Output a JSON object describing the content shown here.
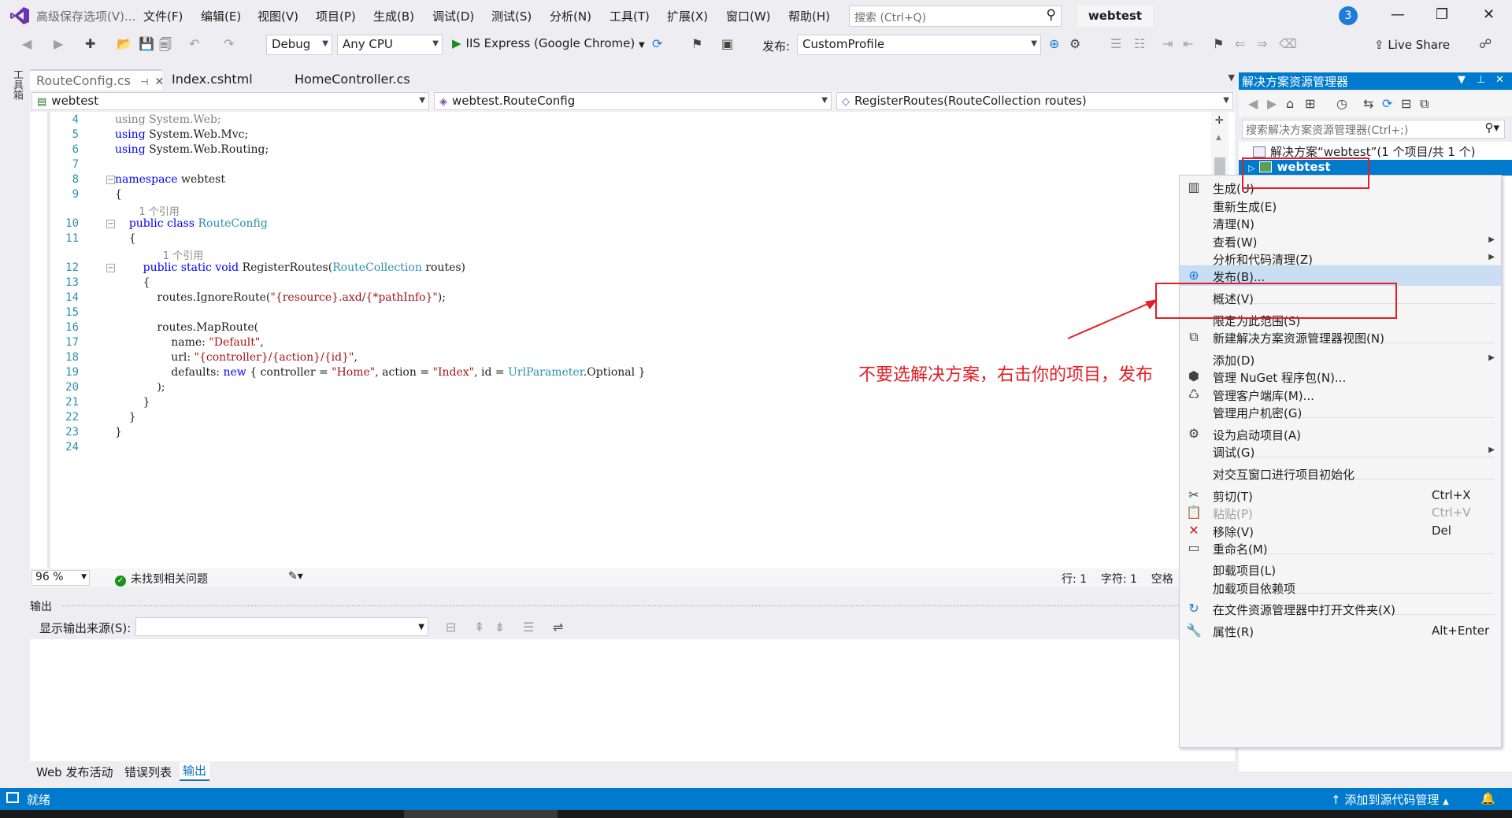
{
  "window": {
    "title_faded": "高级保存选项(V)...",
    "menus": [
      "文件(F)",
      "编辑(E)",
      "视图(V)",
      "项目(P)",
      "生成(B)",
      "调试(D)",
      "测试(S)",
      "分析(N)",
      "工具(T)",
      "扩展(X)",
      "窗口(W)",
      "帮助(H)"
    ],
    "search_placeholder": "搜索 (Ctrl+Q)",
    "solution_name": "webtest",
    "notification_count": "3",
    "minimize": "—",
    "restore": "❐",
    "close": "✕"
  },
  "toolbar": {
    "config": "Debug",
    "platform": "Any CPU",
    "run_target": "IIS Express (Google Chrome)",
    "publish_label": "发布:",
    "publish_profile": "CustomProfile",
    "live_share": "Live Share"
  },
  "toolbox_strip": "工具箱",
  "doc_tabs": [
    {
      "label": "RouteConfig.cs",
      "pin": "⊣",
      "close": "✕"
    },
    {
      "label": "Index.cshtml"
    },
    {
      "label": "HomeController.cs"
    }
  ],
  "navbar": {
    "project": "webtest",
    "class": "webtest.RouteConfig",
    "member": "RegisterRoutes(RouteCollection routes)"
  },
  "code": {
    "ref_hint": "1 个引用",
    "lines": [
      {
        "n": "4",
        "html": "<span class=\"gr\">using System.Web;</span>"
      },
      {
        "n": "5",
        "html": "<span class=\"kw\">using</span> System.Web.Mvc;"
      },
      {
        "n": "6",
        "html": "<span class=\"kw\">using</span> System.Web.Routing;"
      },
      {
        "n": "7",
        "html": ""
      },
      {
        "n": "8",
        "html": "<span class=\"kw\">namespace</span> webtest",
        "fold": true
      },
      {
        "n": "9",
        "html": "{"
      },
      {
        "n": "10",
        "html": "    <span class=\"kw\">public class</span> <span class=\"ty\">RouteConfig</span>",
        "fold": true,
        "hint": true
      },
      {
        "n": "11",
        "html": "    {"
      },
      {
        "n": "12",
        "html": "        <span class=\"kw\">public static void</span> RegisterRoutes(<span class=\"ty\">RouteCollection</span> routes)",
        "fold": true,
        "hint": true
      },
      {
        "n": "13",
        "html": "        {"
      },
      {
        "n": "14",
        "html": "            routes.IgnoreRoute(<span class=\"st\">\"{resource}.axd/{*pathInfo}\"</span>);"
      },
      {
        "n": "15",
        "html": ""
      },
      {
        "n": "16",
        "html": "            routes.MapRoute("
      },
      {
        "n": "17",
        "html": "                name: <span class=\"st\">\"Default\"</span>,"
      },
      {
        "n": "18",
        "html": "                url: <span class=\"st\">\"{controller}/{action}/{id}\"</span>,"
      },
      {
        "n": "19",
        "html": "                defaults: <span class=\"kw\">new</span> { controller = <span class=\"st\">\"Home\"</span>, action = <span class=\"st\">\"Index\"</span>, id = <span class=\"ty\">UrlParameter</span>.Optional }"
      },
      {
        "n": "20",
        "html": "            );"
      },
      {
        "n": "21",
        "html": "        }"
      },
      {
        "n": "22",
        "html": "    }"
      },
      {
        "n": "23",
        "html": "}"
      },
      {
        "n": "24",
        "html": ""
      }
    ]
  },
  "editor_status": {
    "zoom": "96 %",
    "issues": "未找到相关问题",
    "line": "行: 1",
    "char": "字符: 1",
    "space": "空格"
  },
  "output": {
    "title": "输出",
    "source_label": "显示输出来源(S):",
    "source_value": ""
  },
  "bottom_tabs": [
    "Web 发布活动",
    "错误列表",
    "输出"
  ],
  "solution_explorer": {
    "title": "解决方案资源管理器",
    "search_placeholder": "搜索解决方案资源管理器(Ctrl+;)",
    "solution_node": "解决方案“webtest”(1 个项目/共 1 个)",
    "project_node": "webtest"
  },
  "context_menu": [
    {
      "label": "生成(U)",
      "icon": "build-icon"
    },
    {
      "label": "重新生成(E)"
    },
    {
      "label": "清理(N)"
    },
    {
      "label": "查看(W)",
      "submenu": true
    },
    {
      "label": "分析和代码清理(Z)",
      "submenu": true
    },
    {
      "label": "发布(B)...",
      "icon": "globe-icon",
      "highlight": true
    },
    {
      "label": "概述(V)"
    },
    {
      "label": "限定为此范围(S)"
    },
    {
      "label": "新建解决方案资源管理器视图(N)",
      "icon": "new-view-icon"
    },
    {
      "label": "添加(D)",
      "submenu": true
    },
    {
      "label": "管理 NuGet 程序包(N)...",
      "icon": "nuget-icon"
    },
    {
      "label": "管理客户端库(M)...",
      "icon": "client-lib-icon"
    },
    {
      "label": "管理用户机密(G)"
    },
    {
      "label": "设为启动项目(A)",
      "icon": "gear-icon"
    },
    {
      "label": "调试(G)",
      "submenu": true
    },
    {
      "label": "对交互窗口进行项目初始化"
    },
    {
      "label": "剪切(T)",
      "shortcut": "Ctrl+X",
      "icon": "scissors-icon"
    },
    {
      "label": "粘贴(P)",
      "shortcut": "Ctrl+V",
      "icon": "paste-icon",
      "disabled": true
    },
    {
      "label": "移除(V)",
      "shortcut": "Del",
      "icon": "delete-icon"
    },
    {
      "label": "重命名(M)",
      "icon": "rename-icon"
    },
    {
      "label": "卸载项目(L)"
    },
    {
      "label": "加载项目依赖项"
    },
    {
      "label": "在文件资源管理器中打开文件夹(X)",
      "icon": "open-folder-icon"
    },
    {
      "label": "属性(R)",
      "shortcut": "Alt+Enter",
      "icon": "wrench-icon"
    }
  ],
  "annotation": "不要选解决方案，右击你的项目，发布",
  "statusbar": {
    "state": "就绪",
    "source_control": "添加到源代码管理"
  },
  "colors": {
    "accent": "#007acc",
    "annotation_red": "#e31e24",
    "menu_highlight": "#c9def5"
  }
}
